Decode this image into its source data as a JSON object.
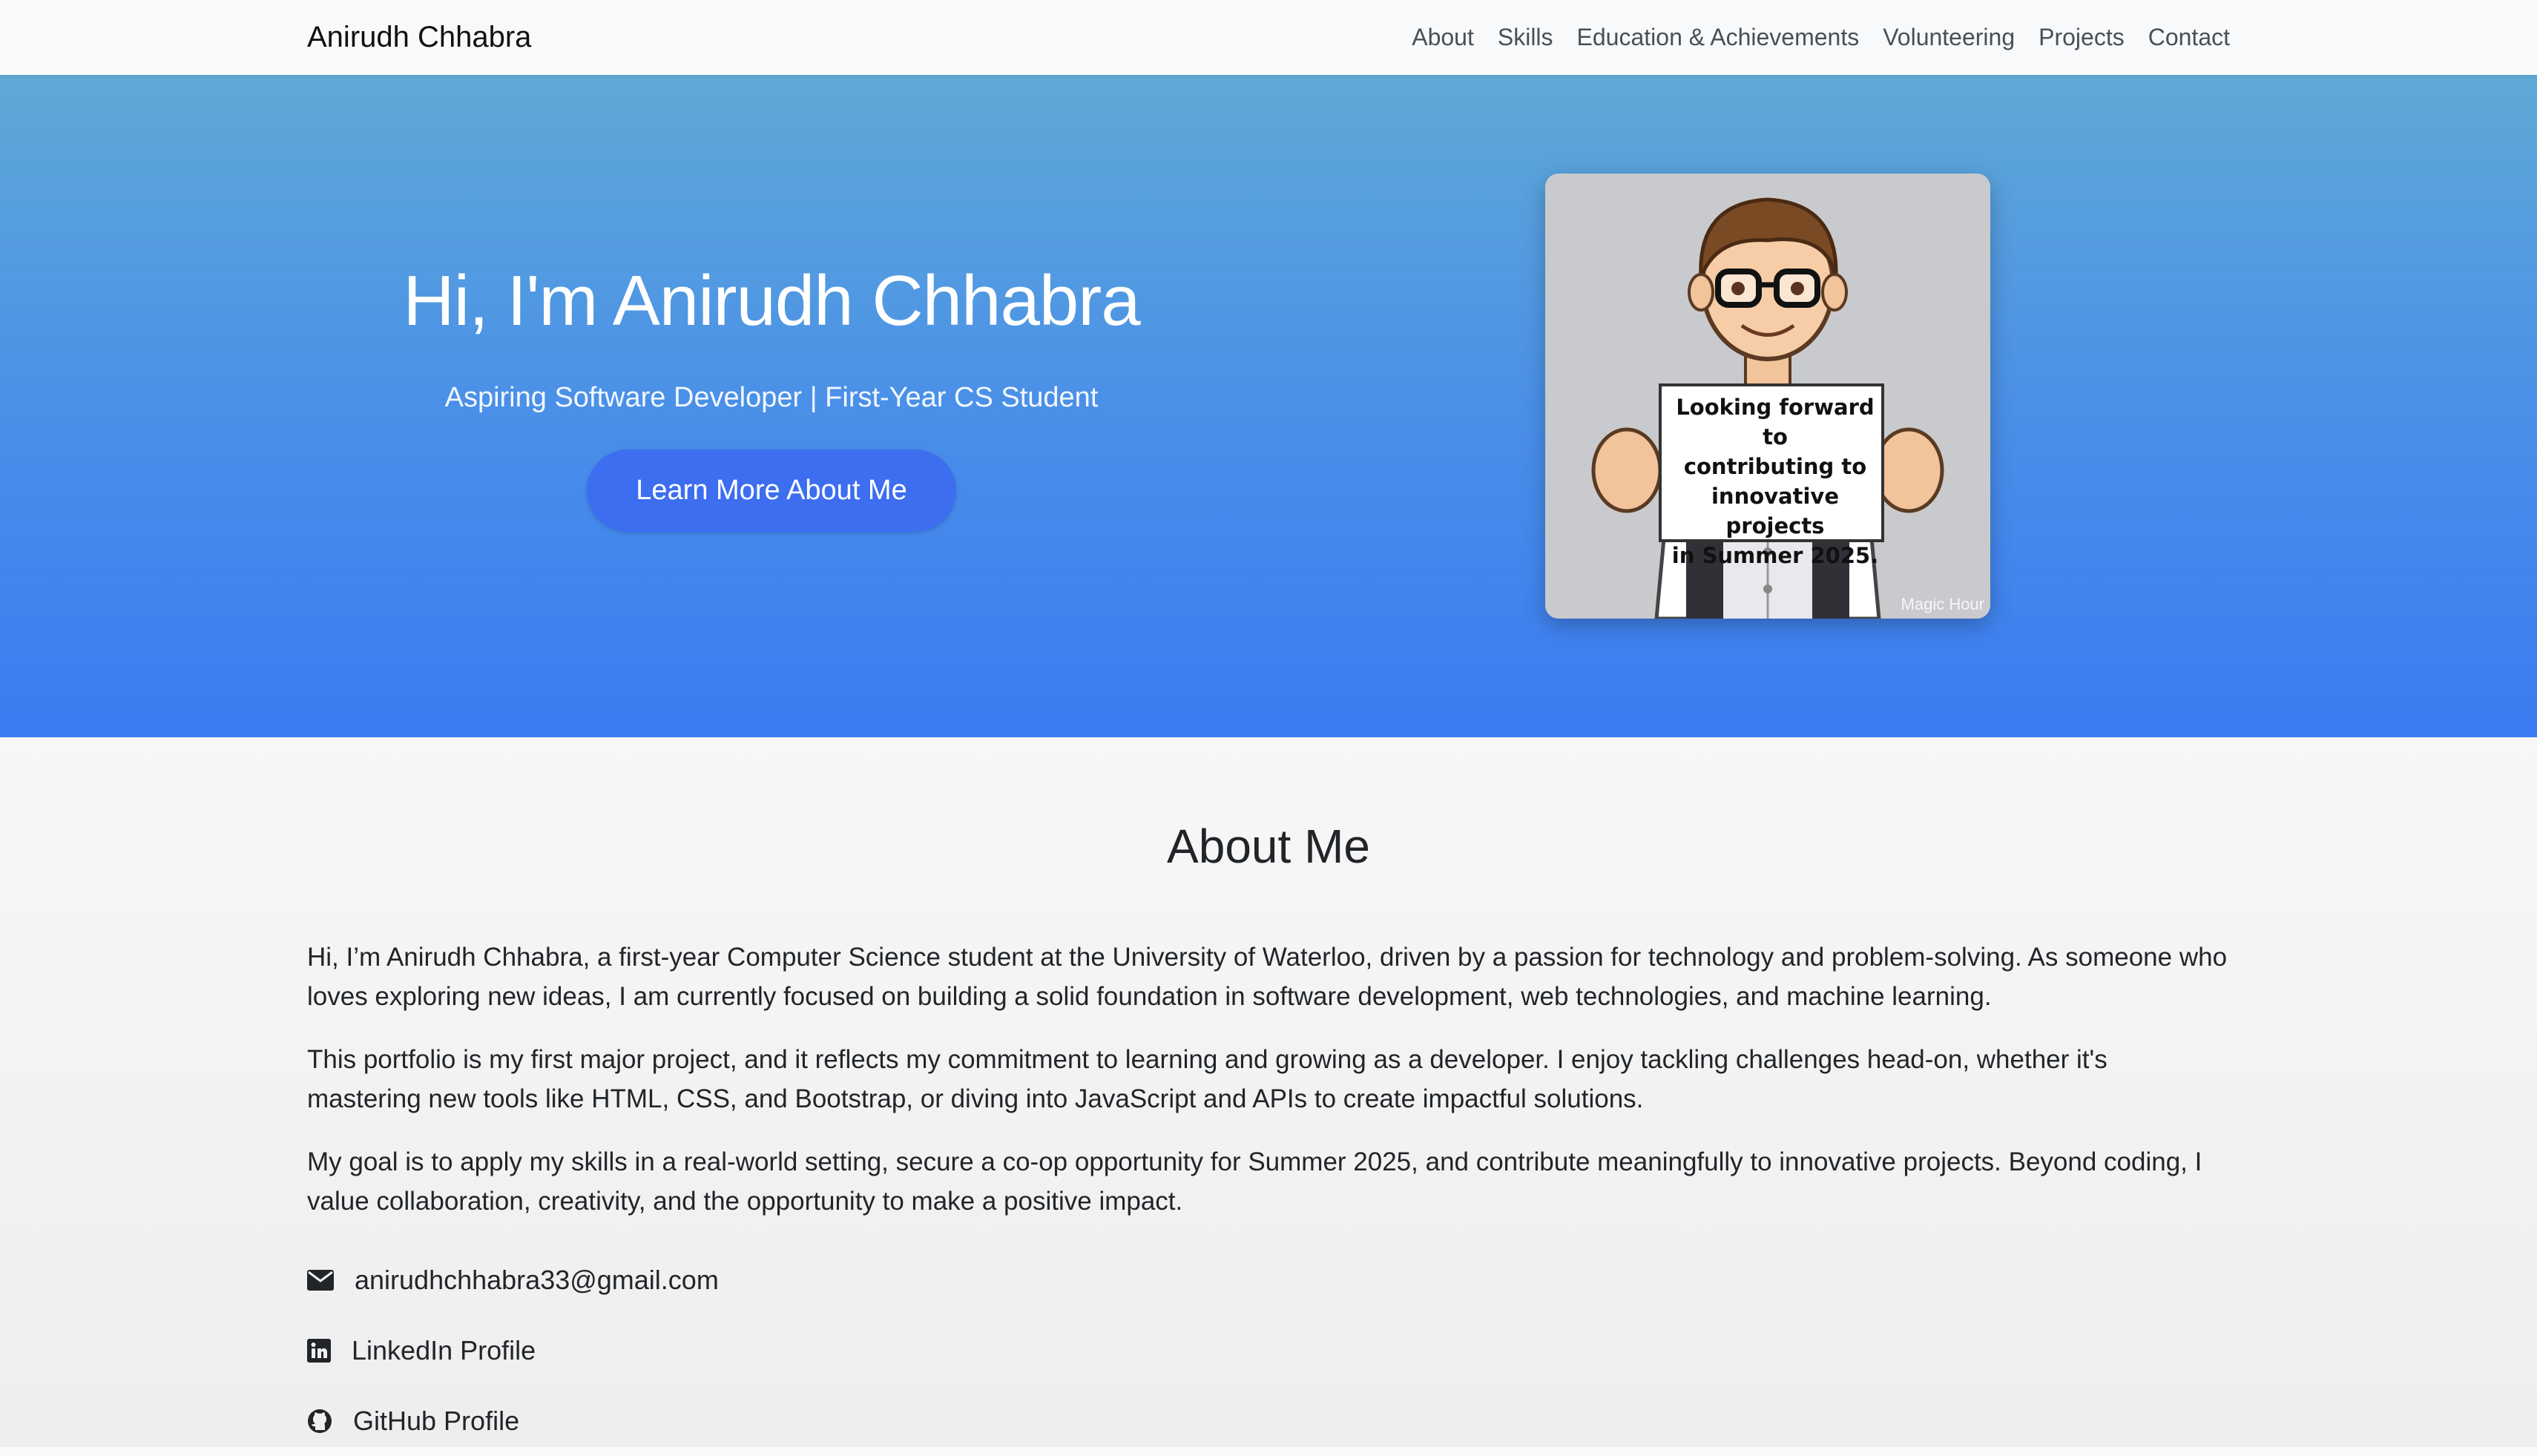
{
  "navbar": {
    "brand": "Anirudh Chhabra",
    "links": [
      "About",
      "Skills",
      "Education & Achievements",
      "Volunteering",
      "Projects",
      "Contact"
    ]
  },
  "hero": {
    "title": "Hi, I'm Anirudh Chhabra",
    "subtitle": "Aspiring Software Developer | First-Year CS Student",
    "button": "Learn More About Me",
    "image": {
      "sign_lines": [
        "Looking forward to",
        "contributing to",
        "innovative projects",
        "in Summer 2025."
      ],
      "watermark": "Magic Hour"
    },
    "colors": {
      "gradient_top": "#5ea9d6",
      "gradient_bottom": "#3a7cf2",
      "button": "#3d6ef0"
    }
  },
  "about": {
    "title": "About Me",
    "paragraphs": [
      "Hi, I’m Anirudh Chhabra, a first-year Computer Science student at the University of Waterloo, driven by a passion for technology and problem-solving. As someone who loves exploring new ideas, I am currently focused on building a solid foundation in software development, web technologies, and machine learning.",
      "This portfolio is my first major project, and it reflects my commitment to learning and growing as a developer. I enjoy tackling challenges head-on, whether it's mastering new tools like HTML, CSS, and Bootstrap, or diving into JavaScript and APIs to create impactful solutions.",
      "My goal is to apply my skills in a real-world setting, secure a co-op opportunity for Summer 2025, and contribute meaningfully to innovative projects. Beyond coding, I value collaboration, creativity, and the opportunity to make a positive impact."
    ],
    "contacts": [
      {
        "icon": "envelope-icon",
        "label": "anirudhchhabra33@gmail.com"
      },
      {
        "icon": "linkedin-icon",
        "label": "LinkedIn Profile"
      },
      {
        "icon": "github-icon",
        "label": "GitHub Profile"
      }
    ]
  }
}
